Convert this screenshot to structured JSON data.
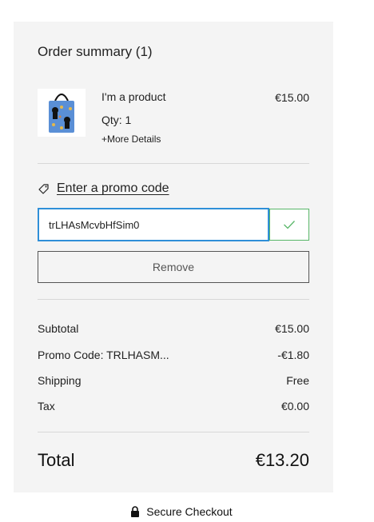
{
  "summary": {
    "title": "Order summary (1)",
    "product": {
      "name": "I'm a product",
      "qty": "Qty: 1",
      "more_details": "+More Details",
      "price": "€15.00"
    },
    "promo": {
      "link_label": "Enter a promo code",
      "code_value": "trLHAsMcvbHfSim0",
      "remove_label": "Remove"
    },
    "totals": {
      "subtotal_label": "Subtotal",
      "subtotal_value": "€15.00",
      "promo_label": "Promo Code: TRLHASM...",
      "promo_value": "-€1.80",
      "shipping_label": "Shipping",
      "shipping_value": "Free",
      "tax_label": "Tax",
      "tax_value": "€0.00",
      "total_label": "Total",
      "total_value": "€13.20"
    }
  },
  "footer": {
    "secure_label": "Secure Checkout"
  },
  "icons": {
    "tag": "tag-icon",
    "check": "check-icon",
    "lock": "lock-icon"
  },
  "colors": {
    "panel_bg": "#f4f4f4",
    "input_focus": "#2f8fd8",
    "success": "#58b668"
  }
}
